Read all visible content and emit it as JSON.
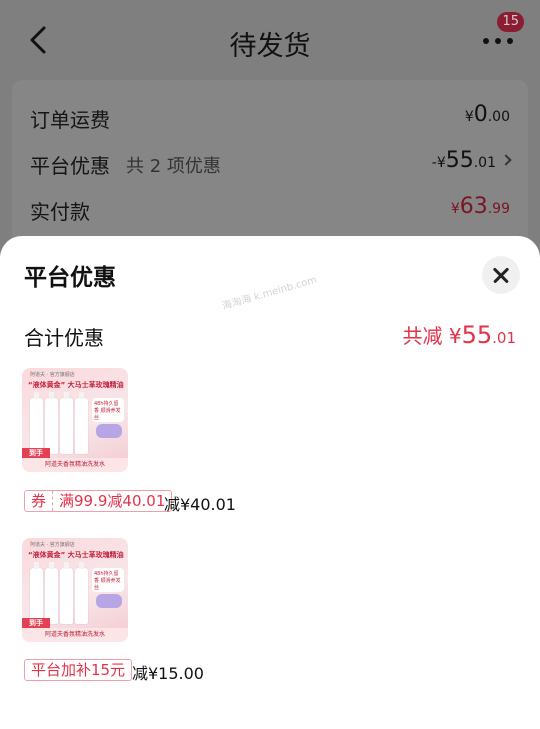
{
  "header": {
    "title": "待发货",
    "badge": "15"
  },
  "summary": {
    "shipping_label": "订单运费",
    "shipping_currency": "¥",
    "shipping_int": "0",
    "shipping_dec": ".00",
    "discount_label": "平台优惠",
    "discount_sub": "共 2 项优惠",
    "discount_prefix": "-¥",
    "discount_int": "55",
    "discount_dec": ".01",
    "paid_label": "实付款",
    "paid_currency": "¥",
    "paid_int": "63",
    "paid_dec": ".99"
  },
  "sheet": {
    "title": "平台优惠",
    "watermark": "海淘海 k.meinb.com",
    "total_label": "合计优惠",
    "total_prefix": "共减 ¥",
    "total_int": "55",
    "total_dec": ".01"
  },
  "items": [
    {
      "product_brand": "阿道夫 · 官方旗舰店",
      "product_slogan": "“液体黄金” 大马士革玫瑰精油",
      "product_badge": "48h持久留香 顺滑养发丝",
      "product_price": "到手119",
      "product_caption": "阿道夫香氛精油洗发水",
      "coupon_tag": "券",
      "coupon_text": "满99.9减40.01",
      "reduce_text": "减¥40.01"
    },
    {
      "product_brand": "阿道夫 · 官方旗舰店",
      "product_slogan": "“液体黄金” 大马士革玫瑰精油",
      "product_badge": "48h持久留香 顺滑养发丝",
      "product_price": "到手119",
      "product_caption": "阿道夫香氛精油洗发水",
      "coupon_text": "平台加补15元",
      "reduce_text": "减¥15.00"
    }
  ],
  "colors": {
    "accent": "#e2334a",
    "overlay": "#7f7f7f"
  }
}
